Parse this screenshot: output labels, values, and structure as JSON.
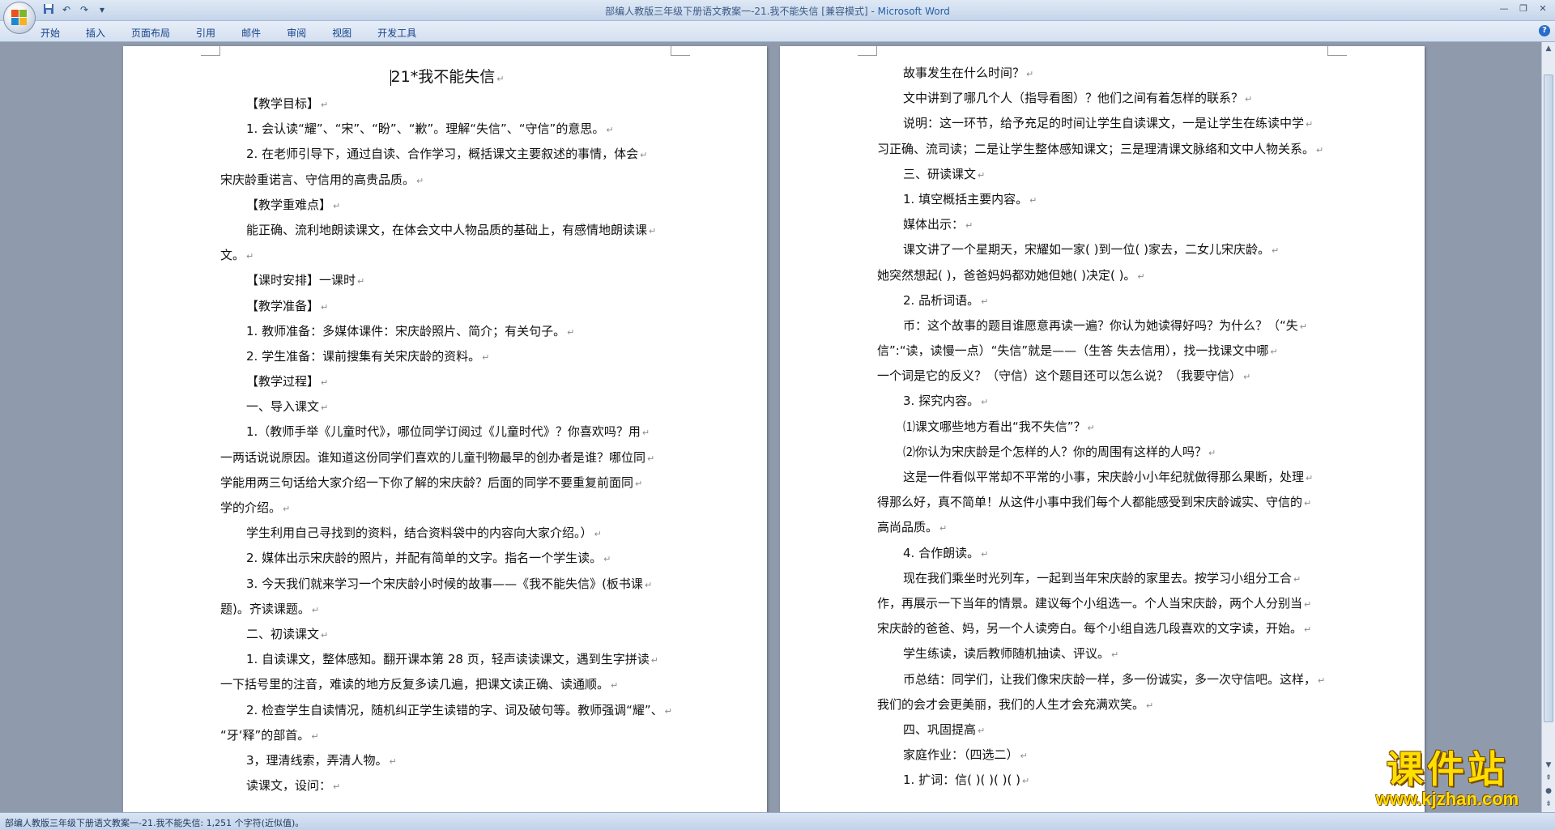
{
  "window": {
    "title": "部编人教版三年级下册语文教案一-21.我不能失信 [兼容模式] - ",
    "app_name": "Microsoft Word"
  },
  "quick_access": {
    "save_icon": "save-icon",
    "undo_icon": "undo-icon",
    "redo_icon": "redo-icon",
    "customize_icon": "chevron-down-icon"
  },
  "ribbon": {
    "tabs": [
      "开始",
      "插入",
      "页面布局",
      "引用",
      "邮件",
      "审阅",
      "视图",
      "开发工具"
    ]
  },
  "page_left": {
    "title": "21*我不能失信",
    "lines": [
      {
        "text": "【教学目标】",
        "indent": true
      },
      {
        "text": "1. 会认读“耀”、“宋”、“盼”、“歉”。理解“失信”、“守信”的意思。",
        "indent": true
      },
      {
        "text": "2. 在老师引导下，通过自读、合作学习，概括课文主要叙述的事情，体会",
        "indent": true
      },
      {
        "text": "宋庆龄重诺言、守信用的高贵品质。",
        "indent": false
      },
      {
        "text": "【教学重难点】",
        "indent": true
      },
      {
        "text": "能正确、流利地朗读课文，在体会文中人物品质的基础上，有感情地朗读课",
        "indent": true
      },
      {
        "text": "文。",
        "indent": false
      },
      {
        "text": "【课时安排】一课时",
        "indent": true
      },
      {
        "text": "【教学准备】",
        "indent": true
      },
      {
        "text": "1. 教师准备：多媒体课件：宋庆龄照片、简介；有关句子。",
        "indent": true
      },
      {
        "text": "2. 学生准备：课前搜集有关宋庆龄的资料。",
        "indent": true
      },
      {
        "text": "【教学过程】",
        "indent": true
      },
      {
        "text": "一、导入课文",
        "indent": true
      },
      {
        "text": "1.（教师手举《儿童时代》，哪位同学订阅过《儿童时代》？你喜欢吗？用",
        "indent": true
      },
      {
        "text": "一两话说说原因。谁知道这份同学们喜欢的儿童刊物最早的创办者是谁？哪位同",
        "indent": false
      },
      {
        "text": "学能用两三句话给大家介绍一下你了解的宋庆龄？后面的同学不要重复前面同",
        "indent": false
      },
      {
        "text": "学的介绍。",
        "indent": false
      },
      {
        "text": "学生利用自己寻找到的资料，结合资料袋中的内容向大家介绍。）",
        "indent": true
      },
      {
        "text": "2. 媒体出示宋庆龄的照片，并配有简单的文字。指名一个学生读。",
        "indent": true
      },
      {
        "text": "3. 今天我们就来学习一个宋庆龄小时候的故事——《我不能失信》(板书课",
        "indent": true
      },
      {
        "text": "题)。齐读课题。",
        "indent": false
      },
      {
        "text": "二、初读课文",
        "indent": true
      },
      {
        "text": "1. 自读课文，整体感知。翻开课本第 28 页，轻声读读课文，遇到生字拼读",
        "indent": true
      },
      {
        "text": "一下括号里的注音，难读的地方反复多读几遍，把课文读正确、读通顺。",
        "indent": false
      },
      {
        "text": "2. 检查学生自读情况，随机纠正学生读错的字、词及破句等。教师强调“耀”、",
        "indent": true
      },
      {
        "text": "“牙‘释”的部首。",
        "indent": false
      },
      {
        "text": "3，理清线索，弄清人物。",
        "indent": true
      },
      {
        "text": "读课文，设问：",
        "indent": true
      }
    ]
  },
  "page_right": {
    "lines": [
      {
        "text": "故事发生在什么时间？",
        "indent": true
      },
      {
        "text": "文中讲到了哪几个人（指导看图）？他们之间有着怎样的联系？",
        "indent": true
      },
      {
        "text": "说明：这一环节，给予充足的时间让学生自读课文，一是让学生在练读中学",
        "indent": true
      },
      {
        "text": "习正确、流司读；二是让学生整体感知课文；三是理清课文脉络和文中人物关系。",
        "indent": false
      },
      {
        "text": "三、研读课文",
        "indent": true
      },
      {
        "text": "1. 填空概括主要内容。",
        "indent": true
      },
      {
        "text": "媒体出示：",
        "indent": true
      },
      {
        "text": "课文讲了一个星期天，宋耀如一家(   )到一位(   )家去，二女儿宋庆龄。",
        "indent": true
      },
      {
        "text": "她突然想起(      )，爸爸妈妈都劝她但她(         )决定(        )。",
        "indent": false
      },
      {
        "text": "2. 品析词语。",
        "indent": true
      },
      {
        "text": "币：这个故事的题目谁愿意再读一遍？你认为她读得好吗？为什么？（“失",
        "indent": true
      },
      {
        "text": "信”:“读，读慢一点）“失信”就是——（生答   失去信用），找一找课文中哪",
        "indent": false
      },
      {
        "text": "一个词是它的反义？（守信）这个题目还可以怎么说？（我要守信）",
        "indent": false
      },
      {
        "text": "3. 探究内容。",
        "indent": true
      },
      {
        "text": "⑴课文哪些地方看出“我不失信”？",
        "indent": true
      },
      {
        "text": "⑵你认为宋庆龄是个怎样的人？你的周围有这样的人吗？",
        "indent": true
      },
      {
        "text": "这是一件看似平常却不平常的小事，宋庆龄小小年纪就做得那么果断，处理",
        "indent": true
      },
      {
        "text": "得那么好，真不简单！从这件小事中我们每个人都能感受到宋庆龄诚实、守信的",
        "indent": false
      },
      {
        "text": "高尚品质。",
        "indent": false
      },
      {
        "text": "4. 合作朗读。",
        "indent": true
      },
      {
        "text": "现在我们乘坐时光列车，一起到当年宋庆龄的家里去。按学习小组分工合",
        "indent": true
      },
      {
        "text": "作，再展示一下当年的情景。建议每个小组选一。个人当宋庆龄，两个人分别当",
        "indent": false
      },
      {
        "text": "宋庆龄的爸爸、妈，另一个人读旁白。每个小组自选几段喜欢的文字读，开始。",
        "indent": false
      },
      {
        "text": "学生练读，读后教师随机抽读、评议。",
        "indent": true
      },
      {
        "text": "币总结：同学们，让我们像宋庆龄一样，多一份诚实，多一次守信吧。这样，",
        "indent": true
      },
      {
        "text": "我们的会才会更美丽，我们的人生才会充满欢笑。",
        "indent": false
      },
      {
        "text": "四、巩固提高",
        "indent": true
      },
      {
        "text": "家庭作业：（四选二）",
        "indent": true
      },
      {
        "text": "1. 扩词：信(     )(   )(   )(    )",
        "indent": true
      }
    ]
  },
  "status_bar": {
    "text": "部编人教版三年级下册语文教案一-21.我不能失信: 1,251 个字符(近似值)。"
  },
  "watermark": {
    "title": "课件站",
    "url": "www.kjzhan.com"
  },
  "colors": {
    "background": "#8f9bad",
    "ribbon_text": "#15428b",
    "watermark": "#ffde00"
  }
}
